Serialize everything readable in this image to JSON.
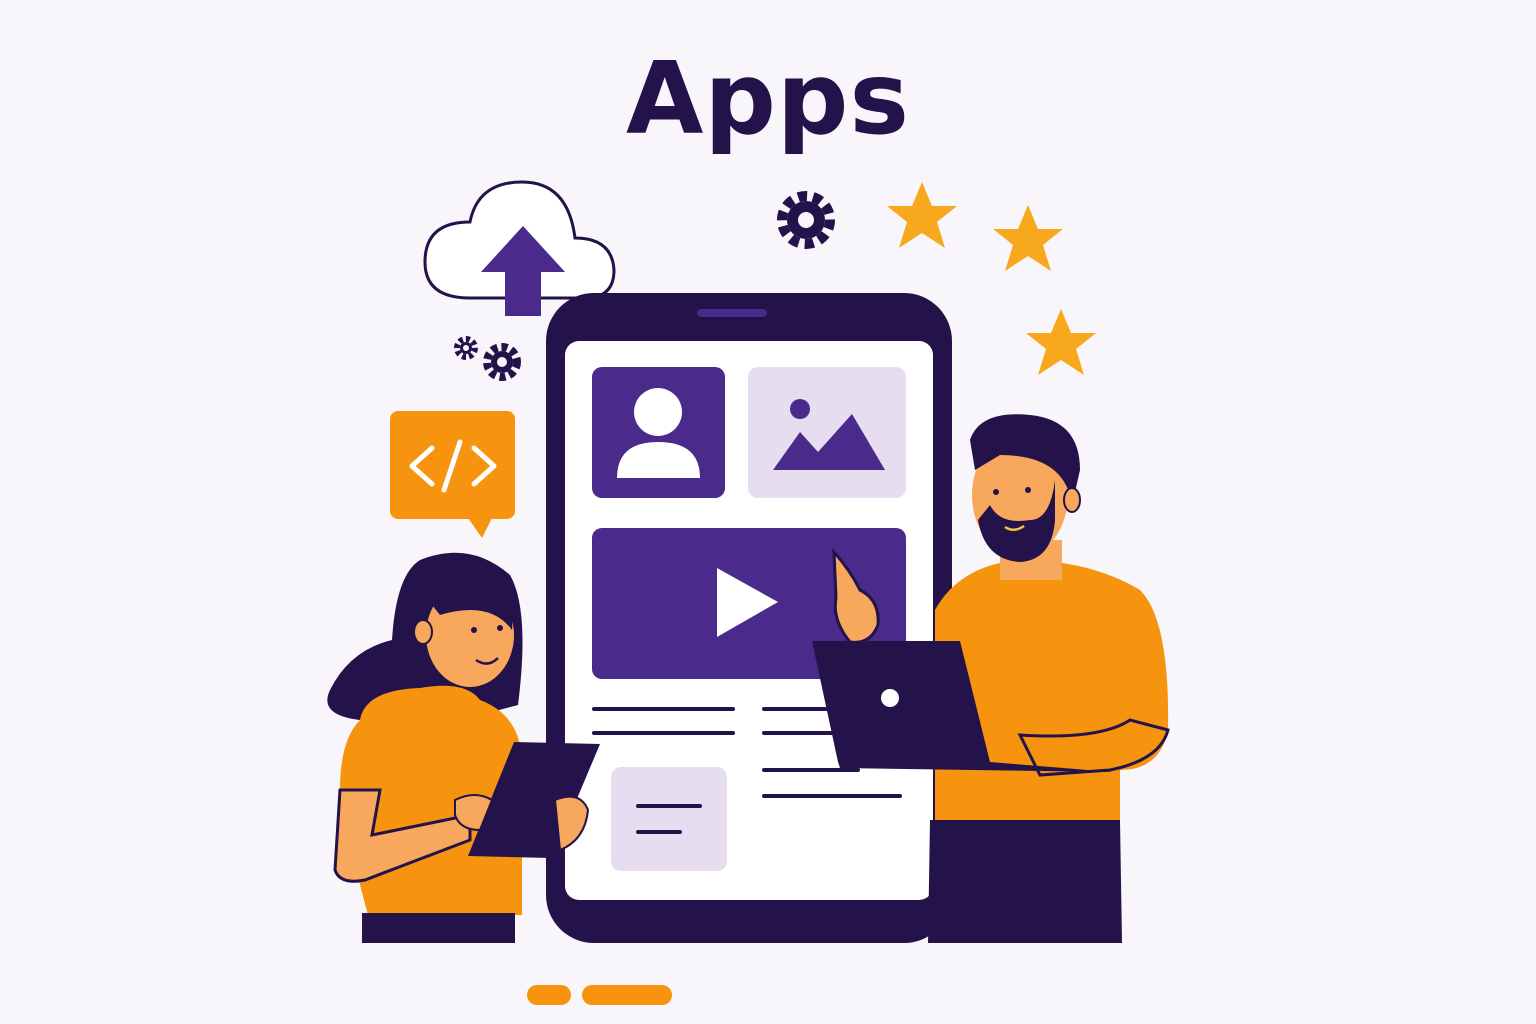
{
  "title": "Apps",
  "icons": {
    "cloud": "cloud-upload-icon",
    "code": "code-bubble-icon",
    "gear": "gear-icon",
    "star": "star-icon",
    "user": "user-avatar-icon",
    "image": "image-icon",
    "play": "play-icon"
  },
  "colors": {
    "background": "#f8f6fa",
    "dark": "#24134a",
    "purple": "#4a2a8a",
    "lavender": "#e6def0",
    "orange": "#f7940f",
    "skin": "#f7a85c"
  }
}
